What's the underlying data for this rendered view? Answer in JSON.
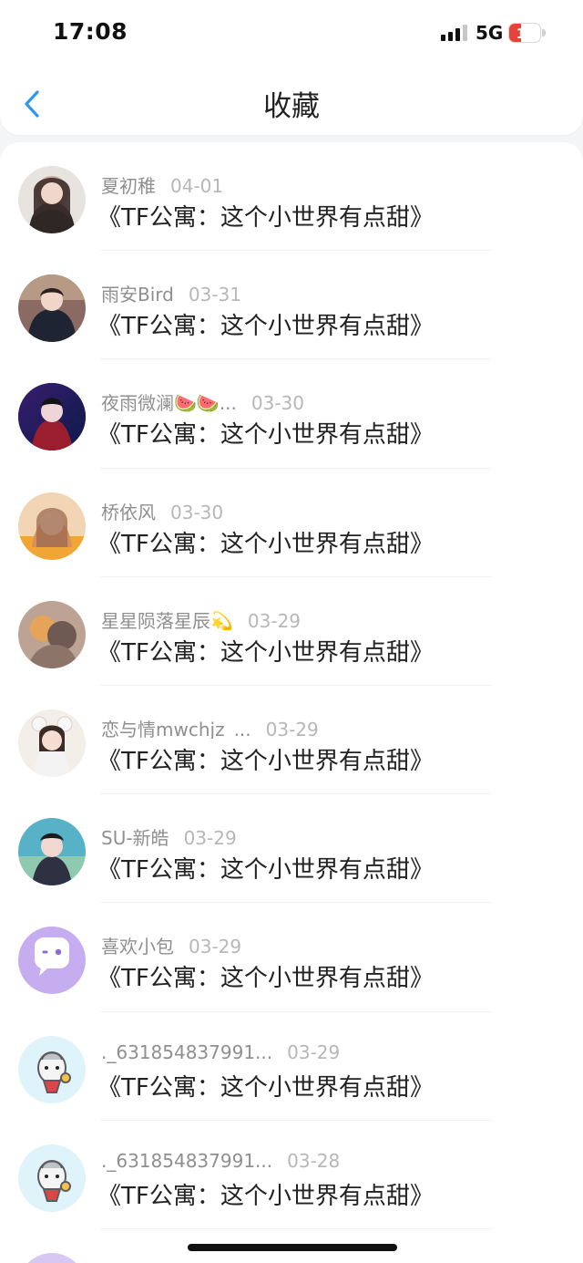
{
  "status_bar": {
    "time": "17:08",
    "network": "5G",
    "battery": "16"
  },
  "header": {
    "title": "收藏"
  },
  "items": [
    {
      "name": "夏初稚",
      "date": "04-01",
      "title": "《TF公寓：这个小世界有点甜》",
      "avatar": "girl-portrait-avatar"
    },
    {
      "name": "雨安Bird",
      "date": "03-31",
      "title": "《TF公寓：这个小世界有点甜》",
      "avatar": "boy-portrait-avatar"
    },
    {
      "name": "夜雨微澜🍉🍉...",
      "date": "03-30",
      "title": "《TF公寓：这个小世界有点甜》",
      "avatar": "stage-performer-avatar"
    },
    {
      "name": "桥依风",
      "date": "03-30",
      "title": "《TF公寓：这个小世界有点甜》",
      "avatar": "anime-girl-avatar"
    },
    {
      "name": "星星陨落星辰💫",
      "date": "03-29",
      "title": "《TF公寓：这个小世界有点甜》",
      "avatar": "warm-photo-avatar"
    },
    {
      "name": "恋与情mwchjz_...",
      "date": "03-29",
      "title": "《TF公寓：这个小世界有点甜》",
      "avatar": "child-ears-avatar"
    },
    {
      "name": "SU-新皓",
      "date": "03-29",
      "title": "《TF公寓：这个小世界有点甜》",
      "avatar": "concert-avatar"
    },
    {
      "name": "喜欢小包",
      "date": "03-29",
      "title": "《TF公寓：这个小世界有点甜》",
      "avatar": "purple-chat-avatar"
    },
    {
      "name": "._631854837991...",
      "date": "03-29",
      "title": "《TF公寓：这个小世界有点甜》",
      "avatar": "cartoon-hero-avatar"
    },
    {
      "name": "._631854837991...",
      "date": "03-28",
      "title": "《TF公寓：这个小世界有点甜》",
      "avatar": "cartoon-hero-avatar"
    }
  ]
}
